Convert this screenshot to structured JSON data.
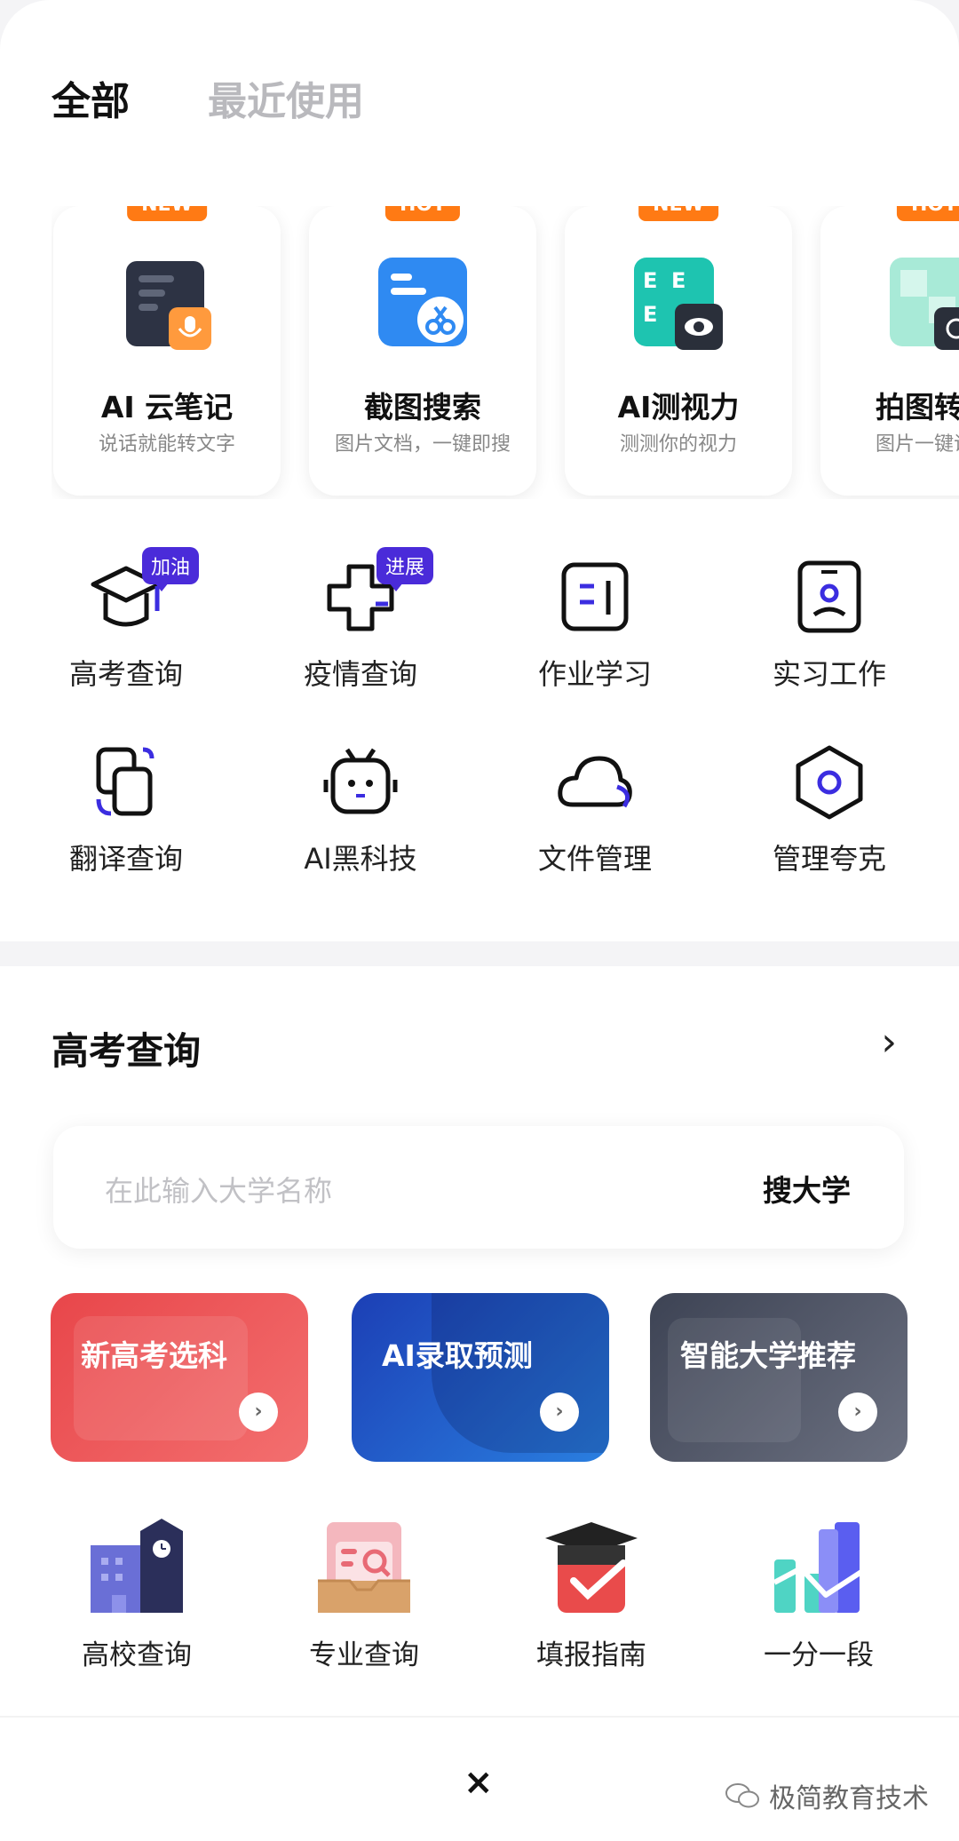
{
  "tabs": [
    {
      "label": "全部"
    },
    {
      "label": "最近使用"
    }
  ],
  "feature_cards": [
    {
      "badge": "NEW",
      "title": "AI 云笔记",
      "subtitle": "说话就能转文字",
      "icon": "voice-note-icon"
    },
    {
      "badge": "HOT",
      "title": "截图搜索",
      "subtitle": "图片文档，一键即搜",
      "icon": "screenshot-search-icon"
    },
    {
      "badge": "NEW",
      "title": "AI测视力",
      "subtitle": "测测你的视力",
      "icon": "eye-test-icon"
    },
    {
      "badge": "HOT",
      "title": "拍图转文",
      "subtitle": "图片一键识别",
      "icon": "photo-to-text-icon"
    }
  ],
  "grid": [
    {
      "label": "高考查询",
      "pill": "加油",
      "icon": "graduation-cap-icon"
    },
    {
      "label": "疫情查询",
      "pill": "进展",
      "icon": "medical-cross-icon"
    },
    {
      "label": "作业学习",
      "icon": "homework-icon"
    },
    {
      "label": "实习工作",
      "icon": "id-badge-icon"
    },
    {
      "label": "翻译查询",
      "icon": "translate-icon"
    },
    {
      "label": "AI黑科技",
      "icon": "robot-icon"
    },
    {
      "label": "文件管理",
      "icon": "cloud-icon"
    },
    {
      "label": "管理夸克",
      "icon": "hexagon-icon"
    }
  ],
  "section": {
    "title": "高考查询",
    "search_placeholder": "在此输入大学名称",
    "search_button": "搜大学",
    "promos": [
      {
        "label": "新高考选科",
        "color": "#ef4f54"
      },
      {
        "label": "AI录取预测",
        "color": "#1e56c8"
      },
      {
        "label": "智能大学推荐",
        "color": "#4a5062"
      }
    ],
    "tools": [
      {
        "label": "高校查询",
        "icon": "university-icon"
      },
      {
        "label": "专业查询",
        "icon": "major-search-icon"
      },
      {
        "label": "填报指南",
        "icon": "application-guide-icon"
      },
      {
        "label": "一分一段",
        "icon": "score-chart-icon"
      }
    ]
  },
  "close_symbol": "×",
  "watermark": "极简教育技术",
  "colors": {
    "accent": "#4a2bd9",
    "badge": "#ff7a14"
  }
}
